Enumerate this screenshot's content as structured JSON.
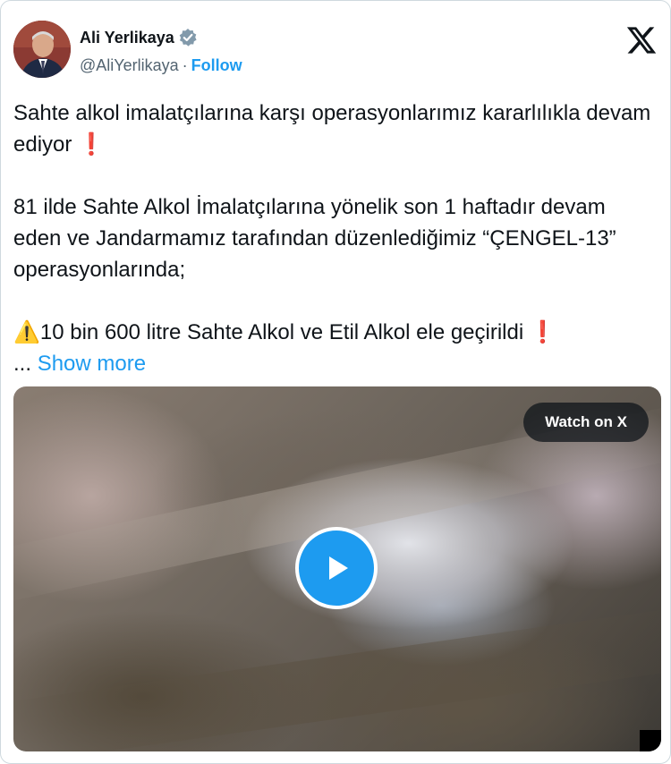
{
  "author": {
    "name": "Ali Yerlikaya",
    "handle": "@AliYerlikaya",
    "separator": "·",
    "follow_label": "Follow"
  },
  "tweet": {
    "line1": "Sahte alkol imalatçılarına karşı operasyonlarımız kararlılıkla devam ediyor",
    "emoji_exclaim": "❗",
    "line2": "81 ilde Sahte Alkol İmalatçılarına yönelik son 1 haftadır devam eden ve Jandarmamız tarafından düzenlediğimiz “ÇENGEL-13” operasyonlarında;",
    "emoji_warning": "⚠️",
    "line3": "10 bin 600 litre Sahte Alkol ve Etil Alkol ele geçirildi",
    "ellipsis": "...",
    "show_more_label": "Show more"
  },
  "media": {
    "watch_label": "Watch on X"
  },
  "colors": {
    "accent": "#1d9bf0",
    "text": "#0f1419",
    "secondary": "#536471",
    "border": "#cfd9de"
  },
  "icons": {
    "verified": "verified-badge-icon",
    "x_logo": "x-logo-icon",
    "play": "play-icon"
  }
}
